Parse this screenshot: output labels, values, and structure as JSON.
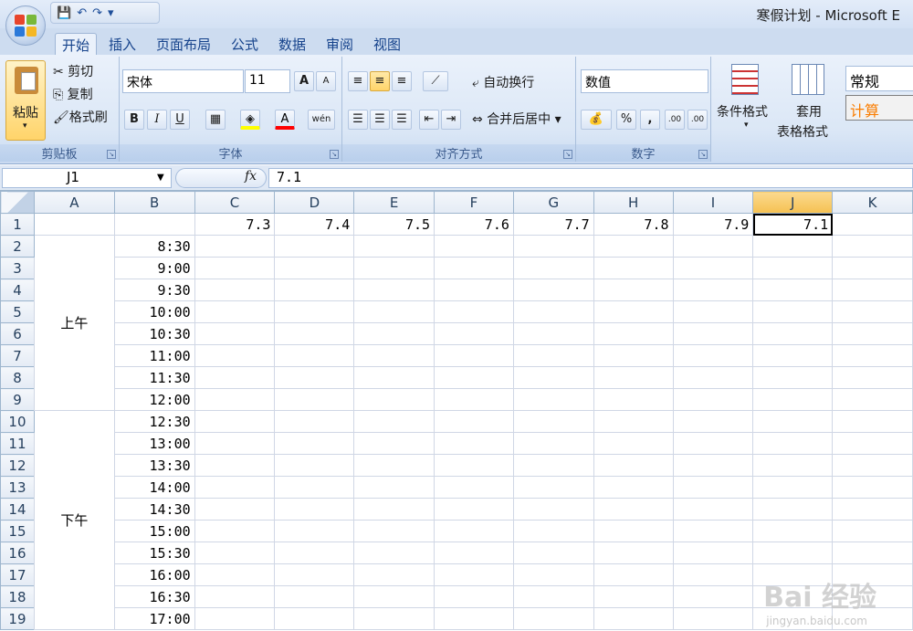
{
  "window": {
    "title": "寒假计划 - Microsoft E"
  },
  "quick_access": {
    "save": "💾",
    "undo": "↶",
    "redo": "↷",
    "more": "▾"
  },
  "tabs": [
    {
      "label": "开始"
    },
    {
      "label": "插入"
    },
    {
      "label": "页面布局"
    },
    {
      "label": "公式"
    },
    {
      "label": "数据"
    },
    {
      "label": "审阅"
    },
    {
      "label": "视图"
    }
  ],
  "ribbon": {
    "clipboard": {
      "label": "剪贴板",
      "paste": "粘贴",
      "cut": "剪切",
      "copy": "复制",
      "format_painter": "格式刷"
    },
    "font": {
      "label": "字体",
      "font_name": "宋体",
      "font_size": "11",
      "bold": "B",
      "italic": "I",
      "underline": "U",
      "grow": "A",
      "shrink": "A",
      "font_color": "A",
      "phonetic": "wén"
    },
    "alignment": {
      "label": "对齐方式",
      "wrap_text": "自动换行",
      "merge_center": "合并后居中"
    },
    "number": {
      "label": "数字",
      "format": "数值",
      "percent": "%",
      "comma": ",",
      "inc_decimal": ".00",
      "dec_decimal": ".00"
    },
    "styles": {
      "conditional": "条件格式",
      "table_format_1": "套用",
      "table_format_2": "表格格式",
      "style_normal": "常规",
      "style_calc": "计算"
    }
  },
  "formula_bar": {
    "name_box": "J1",
    "fx": "fx",
    "formula": "7.1"
  },
  "sheet": {
    "columns": [
      "A",
      "B",
      "C",
      "D",
      "E",
      "F",
      "G",
      "H",
      "I",
      "J",
      "K"
    ],
    "selected_column": "J",
    "row1": [
      "",
      "",
      "7.3",
      "7.4",
      "7.5",
      "7.6",
      "7.7",
      "7.8",
      "7.9",
      "7.1",
      ""
    ],
    "rows": [
      {
        "n": "1"
      },
      {
        "n": "2",
        "time": "8:30"
      },
      {
        "n": "3",
        "time": "9:00"
      },
      {
        "n": "4",
        "time": "9:30"
      },
      {
        "n": "5",
        "time": "10:00"
      },
      {
        "n": "6",
        "time": "10:30"
      },
      {
        "n": "7",
        "time": "11:00"
      },
      {
        "n": "8",
        "time": "11:30"
      },
      {
        "n": "9",
        "time": "12:00"
      },
      {
        "n": "10",
        "time": "12:30"
      },
      {
        "n": "11",
        "time": "13:00"
      },
      {
        "n": "12",
        "time": "13:30"
      },
      {
        "n": "13",
        "time": "14:00"
      },
      {
        "n": "14",
        "time": "14:30"
      },
      {
        "n": "15",
        "time": "15:00"
      },
      {
        "n": "16",
        "time": "15:30"
      },
      {
        "n": "17",
        "time": "16:00"
      },
      {
        "n": "18",
        "time": "16:30"
      },
      {
        "n": "19",
        "time": "17:00"
      }
    ],
    "morning": "上午",
    "afternoon": "下午"
  },
  "watermark": {
    "brand": "Bai 经验",
    "url": "jingyan.baidu.com"
  },
  "colors": {
    "accent": "#f5c152",
    "ribbon": "#dbe7f6"
  }
}
